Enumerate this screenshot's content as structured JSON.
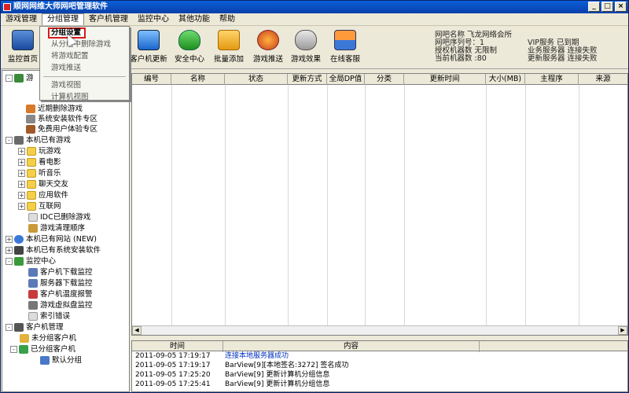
{
  "window": {
    "title": "顺网网维大师网吧管理软件"
  },
  "menu": [
    "游戏管理",
    "分组管理",
    "客户机管理",
    "监控中心",
    "其他功能",
    "帮助"
  ],
  "dropdown": {
    "items": [
      "分组设置",
      "从分组中删除游戏",
      "将游戏配置",
      "游戏推送"
    ],
    "items2": [
      "游戏视图",
      "计算机视图"
    ]
  },
  "toolbar": {
    "buttons": [
      "监控首页",
      "客户机更新",
      "安全中心",
      "批量添加",
      "游戏推送",
      "游戏效果",
      "在线客服"
    ]
  },
  "info": {
    "bar_name": "网吧名称 飞龙网络会所",
    "serial": "网吧序列号：1",
    "auth_count": "授权机器数 无限制",
    "current_count": "当前机器数 :80",
    "vip": "VIP服务 已到期",
    "biz_server": "业务服务器 连接失败",
    "update_server": "更新服务器 连接失败"
  },
  "tree": {
    "nodes": [
      "游",
      "近期删除游戏",
      "系统安装软件专区",
      "免费用户体验专区",
      "本机已有游戏",
      "玩游戏",
      "看电影",
      "听音乐",
      "聊天交友",
      "应用软件",
      "互联网",
      "IDC已删除游戏",
      "游戏清理顺序",
      "本机已有网站 (NEW)",
      "本机已有系统安装软件",
      "监控中心",
      "客户机下载监控",
      "服务器下载监控",
      "客户机温度报警",
      "游戏虚拟盘监控",
      "索引错误",
      "客户机管理",
      "未分组客户机",
      "已分组客户机",
      "默认分组"
    ]
  },
  "grid": {
    "columns": [
      "编号",
      "名称",
      "状态",
      "更新方式",
      "全局DP值",
      "分类",
      "更新时间",
      "大小(MB)",
      "主程序",
      "来源"
    ]
  },
  "log": {
    "headers": [
      "时间",
      "内容"
    ],
    "rows": [
      {
        "time": "2011-09-05 17:19:17",
        "content": "连接本地服务器成功"
      },
      {
        "time": "2011-09-05 17:19:17",
        "content": "BarView[9][本地签名:3272] 签名成功"
      },
      {
        "time": "2011-09-05 17:25:20",
        "content": "BarView[9] 更新计算机分组信息"
      },
      {
        "time": "2011-09-05 17:25:41",
        "content": "BarView[9] 更新计算机分组信息"
      }
    ]
  },
  "colors": {
    "titlebar": "#0a5fd8",
    "highlight_border": "#d81a1a",
    "log_link": "#0030c0"
  }
}
